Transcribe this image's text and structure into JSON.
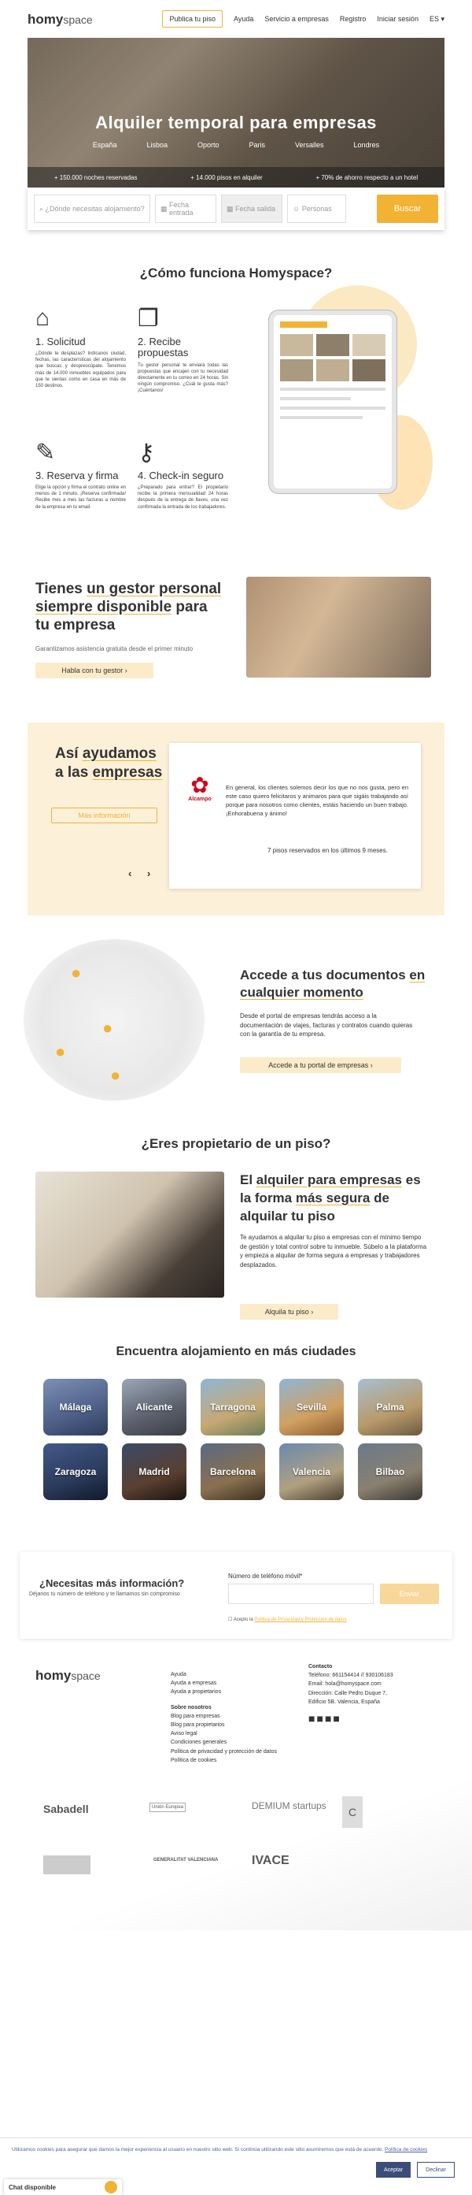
{
  "header": {
    "logo_main": "homy",
    "logo_sub": "space",
    "nav": [
      "Publica tu piso",
      "Ayuda",
      "Servicio a empresas",
      "Registro",
      "Iniciar sesión",
      "ES"
    ]
  },
  "hero": {
    "title": "Alquiler temporal para empresas",
    "cities": [
      "España",
      "Lisboa",
      "Oporto",
      "Paris",
      "Versalles",
      "Londres"
    ],
    "stats": [
      "+ 150.000 noches reservadas",
      "+ 14.000 pisos en alquiler",
      "+ 70% de ahorro respecto a un hotel"
    ]
  },
  "search": {
    "where": "¿Dónde necesitas alojamiento?",
    "start": "Fecha entrada",
    "end": "Fecha salida",
    "people": "Personas",
    "button": "Buscar"
  },
  "how": {
    "title": "¿Cómo funciona Homyspace?",
    "steps": [
      {
        "title": "1. Solicitud",
        "text": "¿Dónde te desplazas? Indícanos ciudad, fechas, las características del alojamiento que buscas y despreocúpate. Tenemos más de 14.000 inmuebles equipados para que te sientas como en casa en más de 150 destinos."
      },
      {
        "title": "2. Recibe propuestas",
        "text": "Tu gestor personal te enviará todas las propuestas que encajen con tu necesidad directamente en tu correo en 24 horas. Sin ningún compromiso. ¿Cuál te gusta más? ¡Cuéntanos!"
      },
      {
        "title": "3. Reserva y firma",
        "text": "Elige la opción y firma el contrato online en menos de 1 minuto. ¡Reserva confirmada! Recibe mes a mes las facturas a nombre de la empresa en tu email."
      },
      {
        "title": "4. Check-in seguro",
        "text": "¿Preparado para entrar? El propietario recibe la primera mensualidad 24 horas después de la entrega de llaves, una vez confirmada la entrada de los trabajadores."
      }
    ]
  },
  "gestor": {
    "title_a": "Tienes ",
    "title_b": "un gestor personal siempre disponible",
    "title_c": " para tu empresa",
    "sub": "Garantizamos asistencia gratuita desde el primer minuto",
    "button": "Habla con tu gestor"
  },
  "ayudamos": {
    "title_a": "Así ",
    "title_b": "ayudamos",
    "title_c": " a las ",
    "title_d": "empresas",
    "button": "Más información",
    "brand": "Alcampo",
    "quote": "En general, los clientes solemos decir los que no nos gusta, pero en este caso quiero felicitaros y animaros para que sigáis trabajando así porque para nosotros como clientes, estáis haciendo un buen trabajo. ¡Enhorabuena y ánimo!",
    "stat": "7 pisos reservados en los últimos 9 meses."
  },
  "docs": {
    "title_a": "Accede a tus documentos ",
    "title_b": "en cualquier momento",
    "text": "Desde el portal de empresas tendrás acceso a la documentación de viajes, facturas y contratos cuando quieras con la garantía de tu empresa.",
    "button": "Accede a tu portal de empresas"
  },
  "prop": {
    "title": "¿Eres propietario de un piso?",
    "h_a": "El ",
    "h_b": "alquiler para empresas",
    "h_c": " es la forma ",
    "h_d": "más segura",
    "h_e": " de alquilar tu piso",
    "text": "Te ayudamos a alquilar tu piso a empresas con el mínimo tiempo de gestión y total control sobre tu inmueble. Súbelo a la plataforma y empieza a alquilar de forma segura a empresas y trabajadores desplazados.",
    "button": "Alquila tu piso"
  },
  "cities": {
    "title": "Encuentra alojamiento en más ciudades",
    "list": [
      "Málaga",
      "Alicante",
      "Tarragona",
      "Sevilla",
      "Palma",
      "Zaragoza",
      "Madrid",
      "Barcelona",
      "Valencia",
      "Bilbao"
    ]
  },
  "info": {
    "title": "¿Necesitas más información?",
    "sub": "Déjanos tu número de teléfono y te llamamos sin compromiso",
    "label": "Número de teléfono móvil*",
    "button": "Enviar",
    "accept_a": "Acepto la ",
    "accept_b": "Política de Privacidad y Protección de datos"
  },
  "footer": {
    "col1": [
      "Ayuda",
      "Ayuda a empresas",
      "Ayuda a propietarios"
    ],
    "about_title": "Sobre nosotros",
    "col2": [
      "Blog para empresas",
      "Blog para propietarios",
      "Aviso legal",
      "Condiciones generales",
      "Política de privacidad y protección de datos",
      "Política de cookies"
    ],
    "contact_title": "Contacto",
    "contact": [
      "Teléfono: 661154414 // 930106183",
      "Email: hola@homyspace.com",
      "Dirección: Calle Pedro Duque 7, Edificio 5B. Valencia, España"
    ],
    "sponsors": [
      "Sabadell",
      "Unión Europea",
      "DEMIUM startups",
      "GENERALITAT VALENCIANA",
      "IVACE"
    ]
  },
  "cookie": {
    "text_a": "Utilizamos cookies para asegurar que damos la mejor experiencia al usuario en nuestro sitio web. Si continúa utilizando este sitio asumiremos que está de acuerdo. ",
    "link": "Política de cookies",
    "accept": "Aceptar",
    "decline": "Declinar",
    "chat": "Chat disponible"
  }
}
